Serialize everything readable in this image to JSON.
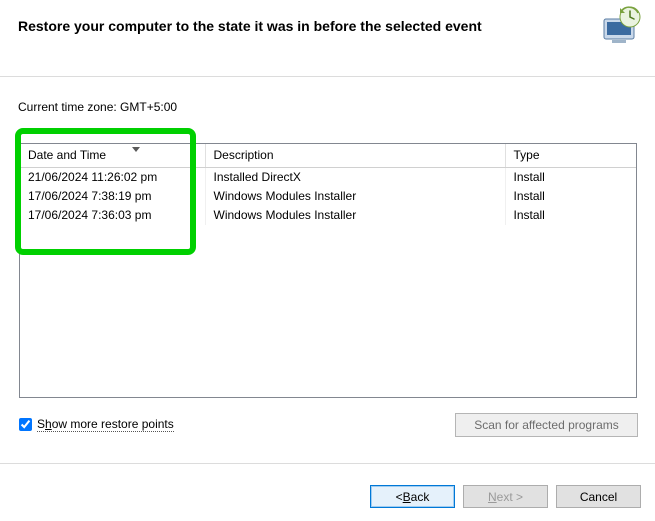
{
  "heading": "Restore your computer to the state it was in before the selected event",
  "timezone_label": "Current time zone: GMT+5:00",
  "columns": {
    "date": "Date and Time",
    "desc": "Description",
    "type": "Type"
  },
  "rows": [
    {
      "date": "21/06/2024 11:26:02 pm",
      "desc": "Installed DirectX",
      "type": "Install"
    },
    {
      "date": "17/06/2024 7:38:19 pm",
      "desc": "Windows Modules Installer",
      "type": "Install"
    },
    {
      "date": "17/06/2024 7:36:03 pm",
      "desc": "Windows Modules Installer",
      "type": "Install"
    }
  ],
  "show_more": {
    "checked": true,
    "pre": "S",
    "mn": "h",
    "post": "ow more restore points"
  },
  "scan_button": "Scan for affected programs",
  "buttons": {
    "back_pre": "< ",
    "back_mn": "B",
    "back_post": "ack",
    "next_pre": "",
    "next_mn": "N",
    "next_post": "ext >",
    "cancel": "Cancel"
  }
}
